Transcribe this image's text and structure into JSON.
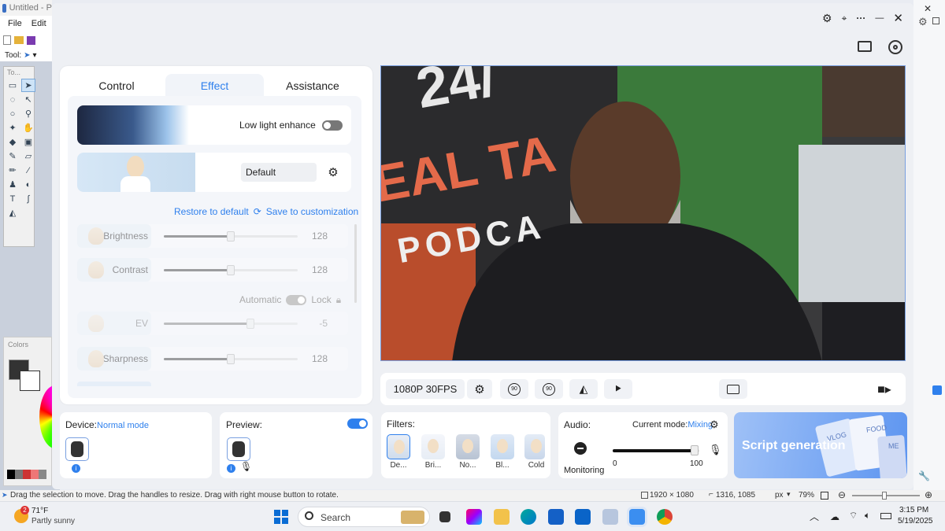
{
  "paint": {
    "title": "Untitled - P",
    "menu": [
      "File",
      "Edit"
    ],
    "tool_label": "Tool:",
    "toolbox_header": "To...",
    "colors_header": "Colors"
  },
  "window_controls": {
    "settings": "⚙",
    "more": "···",
    "minimize": "—",
    "close": "✕"
  },
  "tabs": [
    {
      "label": "Control",
      "active": false
    },
    {
      "label": "Effect",
      "active": true
    },
    {
      "label": "Assistance",
      "active": false
    }
  ],
  "effect": {
    "low_light_label": "Low light enhance",
    "preset_value": "Default",
    "restore_label": "Restore to default",
    "save_label": "Save to customization",
    "automatic_label": "Automatic",
    "lock_label": "Lock",
    "sliders": [
      {
        "label": "Brightness",
        "value": "128",
        "fraction": 0.5
      },
      {
        "label": "Contrast",
        "value": "128",
        "fraction": 0.5
      },
      {
        "label": "EV",
        "value": "-5",
        "fraction": 0.65
      },
      {
        "label": "Sharpness",
        "value": "128",
        "fraction": 0.5
      }
    ]
  },
  "video": {
    "banner_text_1": "24/",
    "banner_text_2": "EAL TA",
    "banner_text_3": "PODCA"
  },
  "control_bar": {
    "resolution": "1080P 30FPS",
    "rotate_left": "90",
    "rotate_right": "90"
  },
  "device": {
    "label": "Device:",
    "mode": "Normal mode"
  },
  "preview": {
    "label": "Preview:"
  },
  "filters": {
    "label": "Filters:",
    "items": [
      "De...",
      "Bri...",
      "No...",
      "Bl...",
      "Cold"
    ]
  },
  "audio": {
    "label": "Audio:",
    "mode_label": "Current mode:",
    "mode_value": "Mixing",
    "monitoring": "Monitoring",
    "min": "0",
    "max": "100",
    "level": 0.97
  },
  "script": {
    "label": "Script generation",
    "tag1": "VLOG",
    "tag2": "FOOD",
    "tag3": "ME"
  },
  "statusbar": {
    "hint": "Drag the selection to move. Drag the handles to resize. Drag with right mouse button to rotate.",
    "size": "1920 × 1080",
    "position": "1316, 1085",
    "unit": "px",
    "zoom": "79%"
  },
  "taskbar": {
    "weather_temp": "71°F",
    "weather_desc": "Partly sunny",
    "weather_badge": "2",
    "search_placeholder": "Search",
    "time": "3:15 PM",
    "date": "5/19/2025"
  },
  "colors": {
    "accent": "#2f80ed",
    "script_card": "#6ea0f2"
  }
}
